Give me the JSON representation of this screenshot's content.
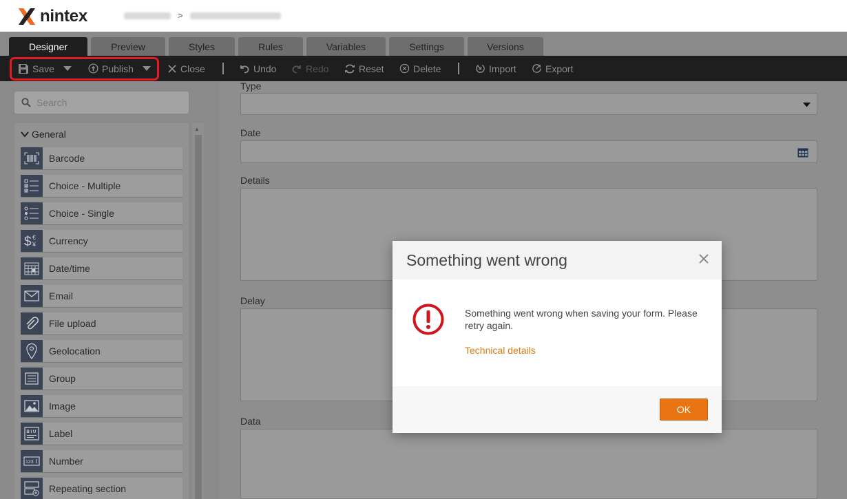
{
  "app": {
    "brand": "nintex",
    "breadcrumb_sep": ">"
  },
  "tabs": [
    {
      "label": "Designer",
      "active": true
    },
    {
      "label": "Preview"
    },
    {
      "label": "Styles"
    },
    {
      "label": "Rules"
    },
    {
      "label": "Variables"
    },
    {
      "label": "Settings"
    },
    {
      "label": "Versions"
    }
  ],
  "toolbar": {
    "save": "Save",
    "publish": "Publish",
    "close": "Close",
    "undo": "Undo",
    "redo": "Redo",
    "reset": "Reset",
    "delete": "Delete",
    "import": "Import",
    "export": "Export"
  },
  "sidebar": {
    "search_placeholder": "Search",
    "group_label": "General",
    "controls": [
      {
        "label": "Barcode",
        "icon": "barcode-icon"
      },
      {
        "label": "Choice - Multiple",
        "icon": "checklist-icon"
      },
      {
        "label": "Choice - Single",
        "icon": "radio-list-icon"
      },
      {
        "label": "Currency",
        "icon": "currency-icon"
      },
      {
        "label": "Date/time",
        "icon": "calendar-icon"
      },
      {
        "label": "Email",
        "icon": "envelope-icon"
      },
      {
        "label": "File upload",
        "icon": "paperclip-icon"
      },
      {
        "label": "Geolocation",
        "icon": "map-pin-icon"
      },
      {
        "label": "Group",
        "icon": "group-icon"
      },
      {
        "label": "Image",
        "icon": "image-icon"
      },
      {
        "label": "Label",
        "icon": "label-icon"
      },
      {
        "label": "Number",
        "icon": "number-icon"
      },
      {
        "label": "Repeating section",
        "icon": "repeating-section-icon"
      }
    ]
  },
  "form": {
    "fields": [
      {
        "label": "Type"
      },
      {
        "label": "Date"
      },
      {
        "label": "Details"
      },
      {
        "label": "Delay"
      },
      {
        "label": "Data"
      }
    ]
  },
  "dialog": {
    "title": "Something went wrong",
    "message": "Something went wrong when saving your form. Please retry again.",
    "link": "Technical details",
    "ok": "OK"
  },
  "colors": {
    "accent": "#e87412",
    "error": "#d0161c",
    "highlight": "#e31b23"
  }
}
